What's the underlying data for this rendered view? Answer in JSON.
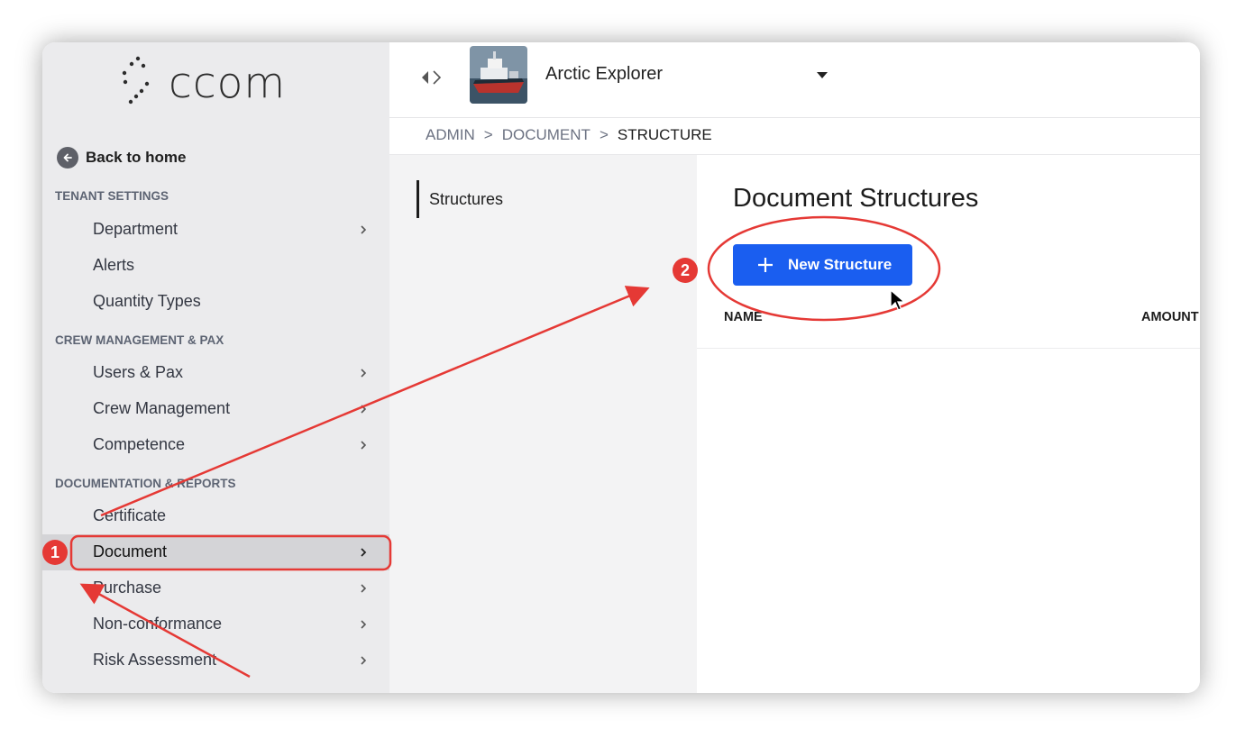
{
  "brand": {
    "logo_text": "ccom"
  },
  "sidebar": {
    "back_label": "Back to home",
    "sections": [
      {
        "title": "TENANT SETTINGS"
      },
      {
        "title": "CREW MANAGEMENT & PAX"
      },
      {
        "title": "DOCUMENTATION & REPORTS"
      }
    ],
    "items": [
      {
        "label": "Department"
      },
      {
        "label": "Alerts"
      },
      {
        "label": "Quantity Types"
      },
      {
        "label": "Users & Pax"
      },
      {
        "label": "Crew Management"
      },
      {
        "label": "Competence"
      },
      {
        "label": "Certificate"
      },
      {
        "label": "Document"
      },
      {
        "label": "Purchase"
      },
      {
        "label": "Non-conformance"
      },
      {
        "label": "Risk Assessment"
      }
    ]
  },
  "header": {
    "vessel_name": "Arctic Explorer"
  },
  "breadcrumb": {
    "items": [
      "ADMIN",
      "DOCUMENT",
      "STRUCTURE"
    ],
    "separator": ">"
  },
  "subnav": {
    "items": [
      {
        "label": "Structures"
      }
    ]
  },
  "main": {
    "title": "Document Structures",
    "new_button_label": "New Structure",
    "columns": [
      "NAME",
      "AMOUNT"
    ]
  },
  "annotations": {
    "step1": "1",
    "step2": "2",
    "color": "#e53935"
  },
  "colors": {
    "accent": "#1a5ef0",
    "sidebar_bg": "#ebebed",
    "active_bg": "#d4d4d7"
  }
}
